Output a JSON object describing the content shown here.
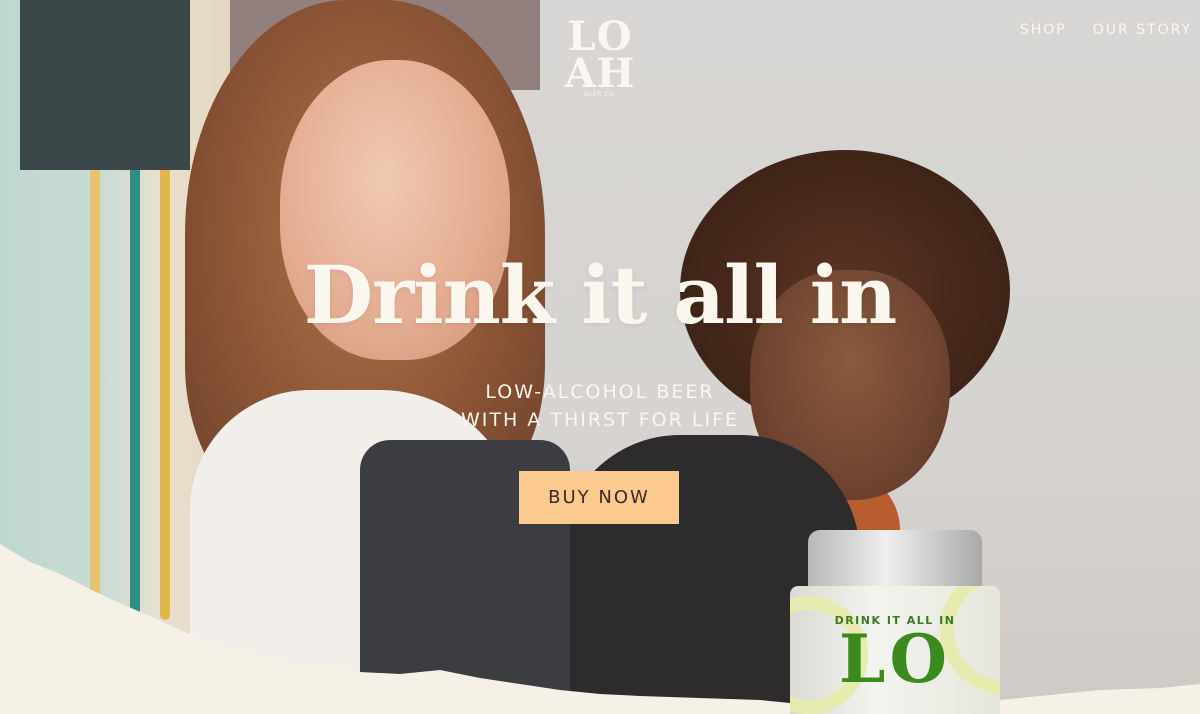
{
  "brand": {
    "logo_line1": "LO",
    "logo_line2": "AH",
    "logo_sub": "BEER CO."
  },
  "nav": {
    "items": [
      {
        "label": "SHOP"
      },
      {
        "label": "OUR STORY"
      }
    ]
  },
  "hero": {
    "headline": "Drink it all in",
    "subhead_line1": "LOW-ALCOHOL BEER",
    "subhead_line2": "WITH A THIRST FOR LIFE",
    "cta_label": "BUY NOW"
  },
  "can": {
    "tagline": "DRINK IT ALL IN",
    "logo": "LO"
  },
  "colors": {
    "cta_background": "#fcc98f",
    "text_light": "#fbf7ef",
    "paper": "#f6f1e6",
    "can_green": "#3a8a1e"
  }
}
